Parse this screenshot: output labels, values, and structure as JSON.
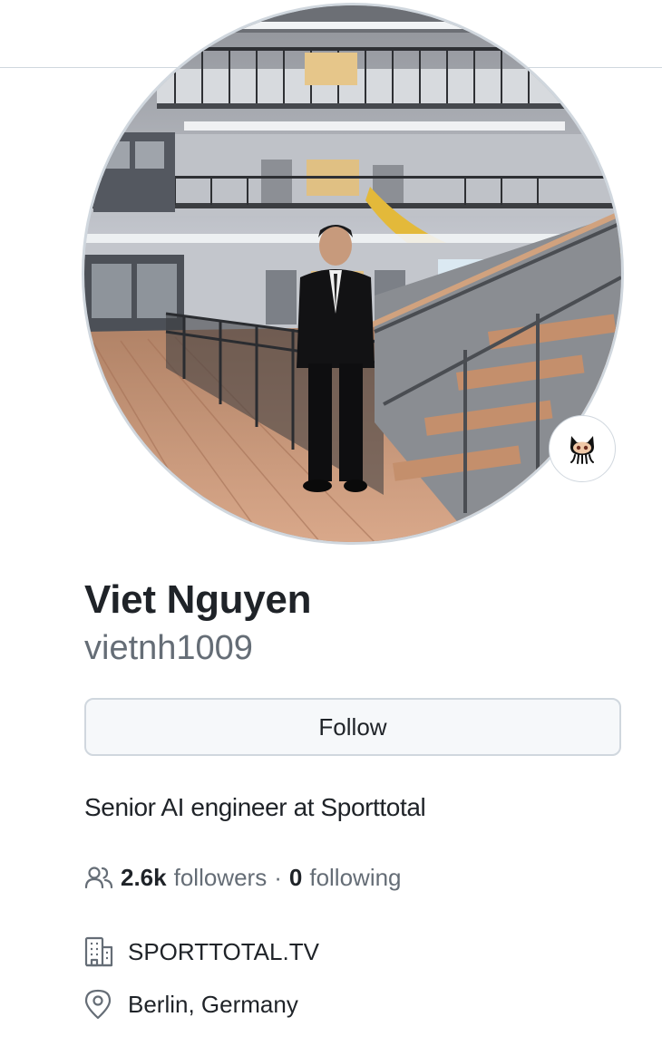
{
  "profile": {
    "full_name": "Viet Nguyen",
    "username": "vietnh1009",
    "follow_label": "Follow",
    "bio": "Senior AI engineer at Sporttotal",
    "followers_count": "2.6k",
    "followers_label": "followers",
    "separator": "·",
    "following_count": "0",
    "following_label": "following",
    "organization": "SPORTTOTAL.TV",
    "location": "Berlin, Germany"
  },
  "icons": {
    "people": "people-icon",
    "organization": "building-icon",
    "location": "location-pin-icon",
    "status": "octocat-icon"
  },
  "colors": {
    "text_primary": "#1f2328",
    "text_muted": "#656d76",
    "border": "#d0d7de",
    "button_bg": "#f6f8fa"
  }
}
